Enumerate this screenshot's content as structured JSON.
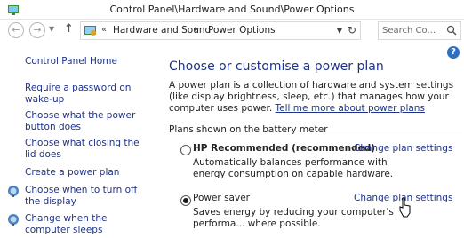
{
  "window": {
    "title": "Control Panel\\Hardware and Sound\\Power Options"
  },
  "nav": {
    "back_icon": "back-arrow-icon",
    "forward_icon": "forward-arrow-icon",
    "up_icon": "up-arrow-icon",
    "breadcrumb_prefix": "«",
    "breadcrumb": [
      "Hardware and Sound",
      "Power Options"
    ],
    "search_placeholder": "Search Co..."
  },
  "sidebar": {
    "home": "Control Panel Home",
    "links": [
      {
        "label": "Require a password on wake-up",
        "icon": null
      },
      {
        "label": "Choose what the power button does",
        "icon": null
      },
      {
        "label": "Choose what closing the lid does",
        "icon": null
      },
      {
        "label": "Create a power plan",
        "icon": null
      },
      {
        "label": "Choose when to turn off the display",
        "icon": "display-icon"
      },
      {
        "label": "Change when the computer sleeps",
        "icon": "display-icon"
      }
    ]
  },
  "main": {
    "heading": "Choose or customise a power plan",
    "description": "A power plan is a collection of hardware and system settings (like display brightness, sleep, etc.) that manages how your computer uses power.",
    "description_link": "Tell me more about power plans",
    "group_label": "Plans shown on the battery meter",
    "plans": [
      {
        "name": "HP Recommended (recommended)",
        "selected": false,
        "change_label": "Change plan settings",
        "description": "Automatically balances performance with energy consumption on capable hardware."
      },
      {
        "name": "Power saver",
        "selected": true,
        "change_label": "Change plan settings",
        "description": "Saves energy by reducing your computer's performa... where possible."
      }
    ]
  },
  "colors": {
    "link": "#1e3287",
    "accent": "#2d6fc5"
  }
}
